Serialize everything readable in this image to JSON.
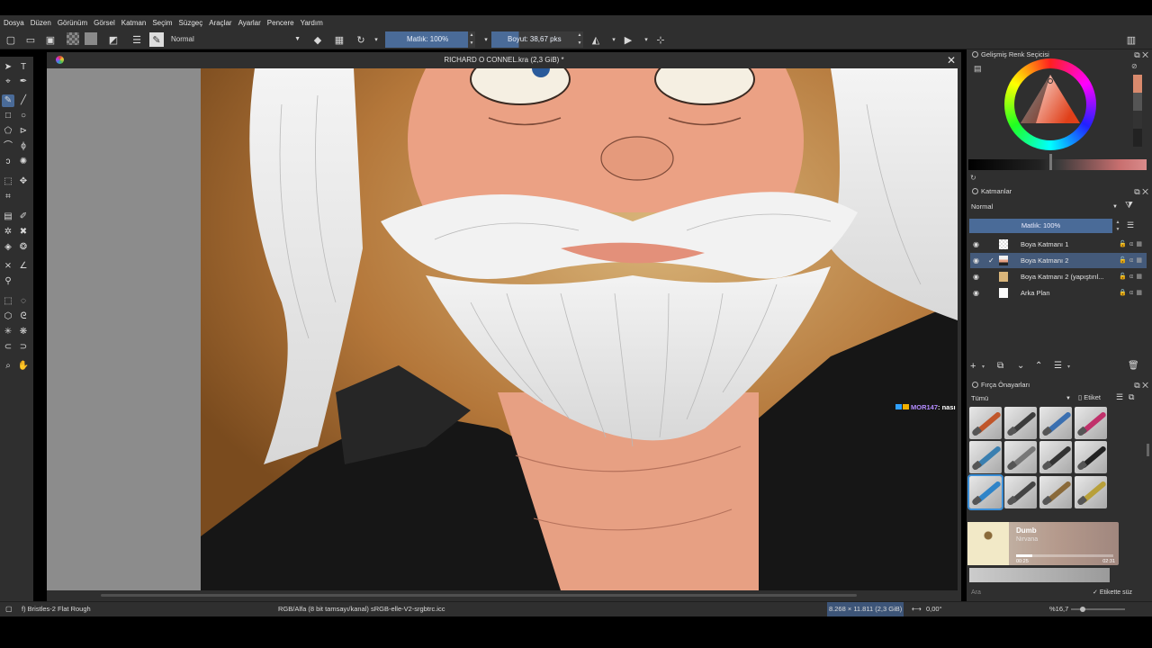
{
  "menu": [
    "Dosya",
    "Düzen",
    "Görünüm",
    "Görsel",
    "Katman",
    "Seçim",
    "Süzgeç",
    "Araçlar",
    "Ayarlar",
    "Pencere",
    "Yardım"
  ],
  "toolbar": {
    "blend_mode": "Normal",
    "opacity_label": "Matlık: 100%",
    "size_label": "Boyut: 38,67 pks"
  },
  "document": {
    "title": "RICHARD O  CONNEL.kra (2,3 GiB) *"
  },
  "chat_overlay": {
    "user": "MOR147",
    "message": ": nası"
  },
  "panels": {
    "color": {
      "title": "Gelişmiş Renk Seçicisi"
    },
    "layers": {
      "title": "Katmanlar",
      "blend_mode": "Normal",
      "opacity_label": "Matlık:  100%",
      "items": [
        {
          "name": "Boya Katmanı 1",
          "selected": false,
          "visible": true
        },
        {
          "name": "Boya Katmanı 2",
          "selected": true,
          "visible": true
        },
        {
          "name": "Boya Katmanı 2 (yapıştırıl...",
          "selected": false,
          "visible": true
        },
        {
          "name": "Arka Plan",
          "selected": false,
          "visible": true,
          "locked": true
        }
      ]
    },
    "brushes": {
      "title": "Fırça Önayarları",
      "filter": "Tümü",
      "tag_label": "Etiket",
      "search_placeholder": "Ara",
      "filter_by_tag": "Etikette süz"
    }
  },
  "media_overlay": {
    "track": "Dumb",
    "artist": "Nirvana",
    "elapsed": "00:25",
    "duration": "02:31",
    "progress_fraction": 0.17
  },
  "status": {
    "brush": "f) Bristles-2 Flat Rough",
    "color_space": "RGB/Alfa (8 bit tamsayı/kanal)  sRGB-elle-V2-srgbtrc.icc",
    "dimensions": "8.268 × 11.811 (2,3 GiB)",
    "rotation": "0,00°",
    "zoom": "%16,7"
  }
}
